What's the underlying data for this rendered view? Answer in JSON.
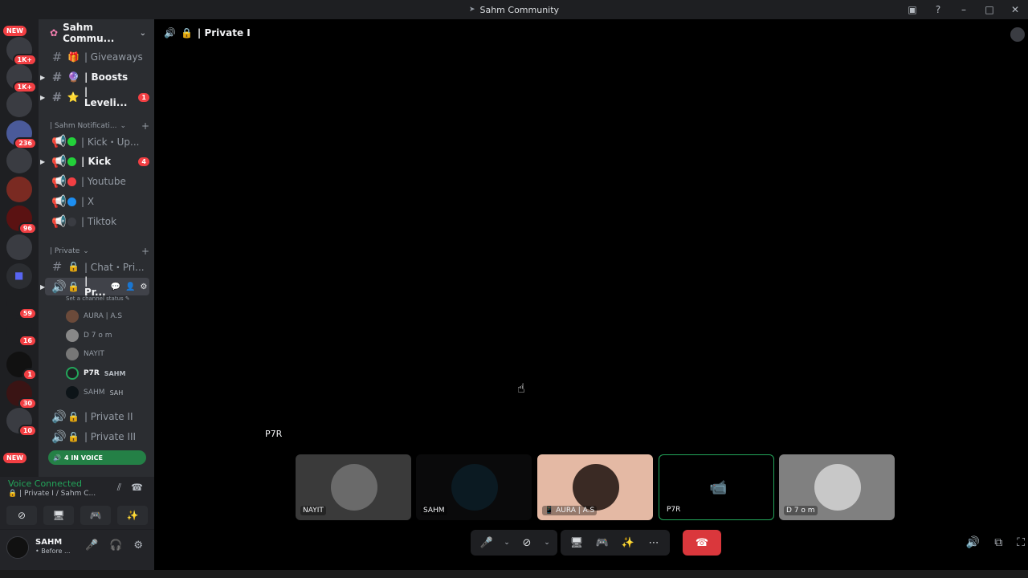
{
  "window": {
    "title": "Sahm Community"
  },
  "servers": [
    {
      "badge": "NEW",
      "kind": "new"
    },
    {
      "badge": "1K+"
    },
    {
      "badge": "1K+"
    },
    {
      "badge": ""
    },
    {
      "badge": "236"
    },
    {
      "badge": ""
    },
    {
      "badge": ""
    },
    {
      "badge": "96"
    },
    {
      "badge": ""
    },
    {
      "badge": ""
    },
    {
      "badge": "59"
    },
    {
      "badge": "16"
    },
    {
      "badge": "1"
    },
    {
      "badge": "30"
    },
    {
      "badge": "10"
    },
    {
      "badge": "NEW",
      "kind": "new"
    }
  ],
  "sidebar": {
    "server_name": "Sahm Commu...",
    "channels_top": [
      {
        "label": "| Giveaways",
        "emoji": "🎁",
        "bold": false
      },
      {
        "label": "| Boosts",
        "emoji": "🔮",
        "bold": true
      },
      {
        "label": "| Leveli...",
        "emoji": "⭐",
        "bold": true,
        "badge": "1"
      }
    ],
    "category_notifications": "| Sahm Notificati...",
    "channels_notif": [
      {
        "label": "| Kick・Up...",
        "color": "#23d13a",
        "bold": false
      },
      {
        "label": "| Kick",
        "color": "#23d13a",
        "bold": true,
        "badge": "4"
      },
      {
        "label": "| Youtube",
        "color": "#f23f43",
        "bold": false
      },
      {
        "label": "| X",
        "color": "#1d8ff2",
        "bold": false
      },
      {
        "label": "| Tiktok",
        "color": "#3a3c42",
        "bold": false
      }
    ],
    "category_private": "| Private",
    "chat_private": "| Chat・Pri...",
    "voice_active": "| Pr...",
    "status_line": "Set a channel status",
    "members": [
      {
        "name": "AURA | A.S",
        "tag": ""
      },
      {
        "name": "D 7 o m",
        "tag": ""
      },
      {
        "name": "NAYIT",
        "tag": ""
      },
      {
        "name": "P7R",
        "tag": "SAHM",
        "bold": true,
        "speaking": true
      },
      {
        "name": "SAHM",
        "tag": "SAH"
      }
    ],
    "voice_more": [
      "| Private II",
      "| Private III"
    ],
    "in_voice": "4 IN VOICE"
  },
  "voice_panel": {
    "title": "Voice Connected",
    "subtitle": "| Private I / Sahm C..."
  },
  "user_panel": {
    "name": "SAHM",
    "status": "• Before ..."
  },
  "main": {
    "channel_title": "| Private I",
    "focused_name": "P7R",
    "tiles": [
      {
        "name": "NAYIT",
        "style": "grey-dark"
      },
      {
        "name": "SAHM",
        "style": "dark"
      },
      {
        "name": "AURA | A.S",
        "style": "peach"
      },
      {
        "name": "P7R",
        "style": "cam"
      },
      {
        "name": "D 7 o m",
        "style": "grey"
      }
    ]
  },
  "icons": {
    "mic": "🎤",
    "camera_off": "📷",
    "screen": "🖥",
    "activity": "🎮",
    "soundboard": "✨",
    "more": "⋯",
    "hangup": "☎",
    "volume": "🔊",
    "popout": "⧉",
    "fullscreen": "⛶"
  }
}
